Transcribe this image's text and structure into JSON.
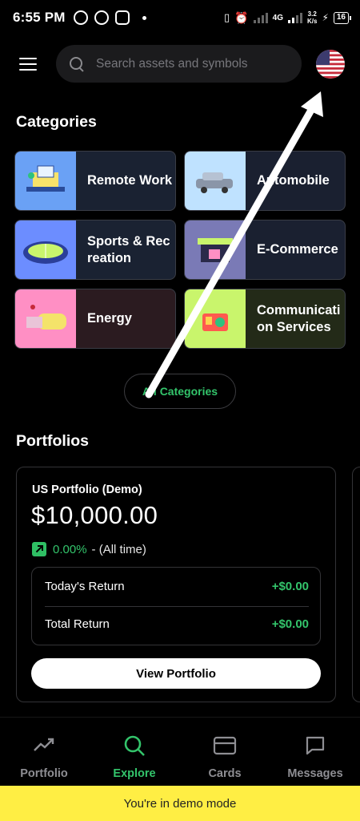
{
  "status_bar": {
    "time": "6:55 PM",
    "network_type": "4G",
    "speed_value": "3.2",
    "speed_unit": "K/s",
    "battery": "16"
  },
  "header": {
    "search_placeholder": "Search assets and symbols",
    "flag_icon": "us-flag-icon"
  },
  "categories": {
    "title": "Categories",
    "items": [
      {
        "label": "Remote Work",
        "thumb_color": "#6aa1f5",
        "icon": "remote-work-illustration"
      },
      {
        "label": "Automobile",
        "thumb_color": "#bfe2ff",
        "icon": "car-illustration"
      },
      {
        "label": "Sports & Recreation",
        "thumb_color": "#6c8dff",
        "icon": "stadium-illustration"
      },
      {
        "label": "E-Commerce",
        "thumb_color": "#7a7ab6",
        "icon": "shop-illustration"
      },
      {
        "label": "Energy",
        "thumb_color": "#ff8fc4",
        "icon": "battery-illustration"
      },
      {
        "label": "Communication Services",
        "thumb_color": "#c9f56c",
        "icon": "radio-illustration"
      }
    ],
    "all_label": "All Categories"
  },
  "portfolios": {
    "title": "Portfolios",
    "card": {
      "name": "US Portfolio (Demo)",
      "value": "$10,000.00",
      "change_pct": "0.00%",
      "change_period": "- (All time)",
      "todays_return_label": "Today's Return",
      "todays_return_value": "+$0.00",
      "total_return_label": "Total Return",
      "total_return_value": "+$0.00",
      "view_button": "View Portfolio"
    }
  },
  "bottom_nav": [
    {
      "label": "Portfolio",
      "icon": "trend-icon",
      "active": false
    },
    {
      "label": "Explore",
      "icon": "search-icon",
      "active": true
    },
    {
      "label": "Cards",
      "icon": "card-icon",
      "active": false
    },
    {
      "label": "Messages",
      "icon": "message-icon",
      "active": false
    }
  ],
  "demo_banner": "You're in demo mode",
  "colors": {
    "accent": "#33c46b",
    "banner": "#ffee44",
    "background": "#000000"
  }
}
